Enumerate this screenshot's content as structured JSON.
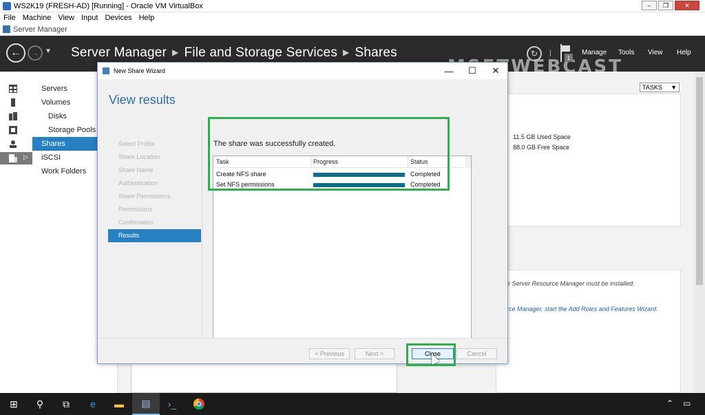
{
  "vbox": {
    "title": "WS2K19 (FRESH-AD) [Running] - Oracle VM VirtualBox",
    "menu": [
      "File",
      "Machine",
      "View",
      "Input",
      "Devices",
      "Help"
    ],
    "win_min": "–",
    "win_restore": "❐",
    "win_close": "✕"
  },
  "server_manager": {
    "window_title": "Server Manager",
    "breadcrumb": [
      "Server Manager",
      "File and Storage Services",
      "Shares"
    ],
    "watermark": "MSFTWEBCAST",
    "notification_count": "1",
    "header_menu": [
      "Manage",
      "Tools",
      "View",
      "Help"
    ],
    "nav_items": [
      {
        "label": "Servers",
        "sub": false,
        "selected": false
      },
      {
        "label": "Volumes",
        "sub": false,
        "selected": false
      },
      {
        "label": "Disks",
        "sub": true,
        "selected": false
      },
      {
        "label": "Storage Pools",
        "sub": true,
        "selected": false
      },
      {
        "label": "Shares",
        "sub": false,
        "selected": true
      },
      {
        "label": "iSCSI",
        "sub": false,
        "selected": false
      },
      {
        "label": "Work Folders",
        "sub": false,
        "selected": false
      }
    ],
    "tasks_label": "TASKS",
    "used_space": "11.5 GB Used Space",
    "free_space": "88.0 GB Free Space",
    "fsrm_note": "e Server Resource Manager must be installed.",
    "fsrm_link": "rce Manager, start the Add Roles and Features Wizard."
  },
  "wizard": {
    "title": "New Share Wizard",
    "heading": "View results",
    "steps": [
      {
        "label": "Select Profile",
        "selected": false
      },
      {
        "label": "Share Location",
        "selected": false
      },
      {
        "label": "Share Name",
        "selected": false
      },
      {
        "label": "Authentication",
        "selected": false
      },
      {
        "label": "Share Permissions",
        "selected": false
      },
      {
        "label": "Permissions",
        "selected": false
      },
      {
        "label": "Confirmation",
        "selected": false
      },
      {
        "label": "Results",
        "selected": true
      }
    ],
    "success_message": "The share was successfully created.",
    "columns": [
      "Task",
      "Progress",
      "Status"
    ],
    "rows": [
      {
        "task": "Create NFS share",
        "progress": 1.0,
        "status": "Completed"
      },
      {
        "task": "Set NFS permissions",
        "progress": 1.0,
        "status": "Completed"
      }
    ],
    "buttons": {
      "previous": "< Previous",
      "next": "Next >",
      "close": "Close",
      "cancel": "Cancel"
    },
    "accent_color": "#2680c2",
    "progress_color": "#0f6f87",
    "highlight_color": "#2db04b"
  }
}
